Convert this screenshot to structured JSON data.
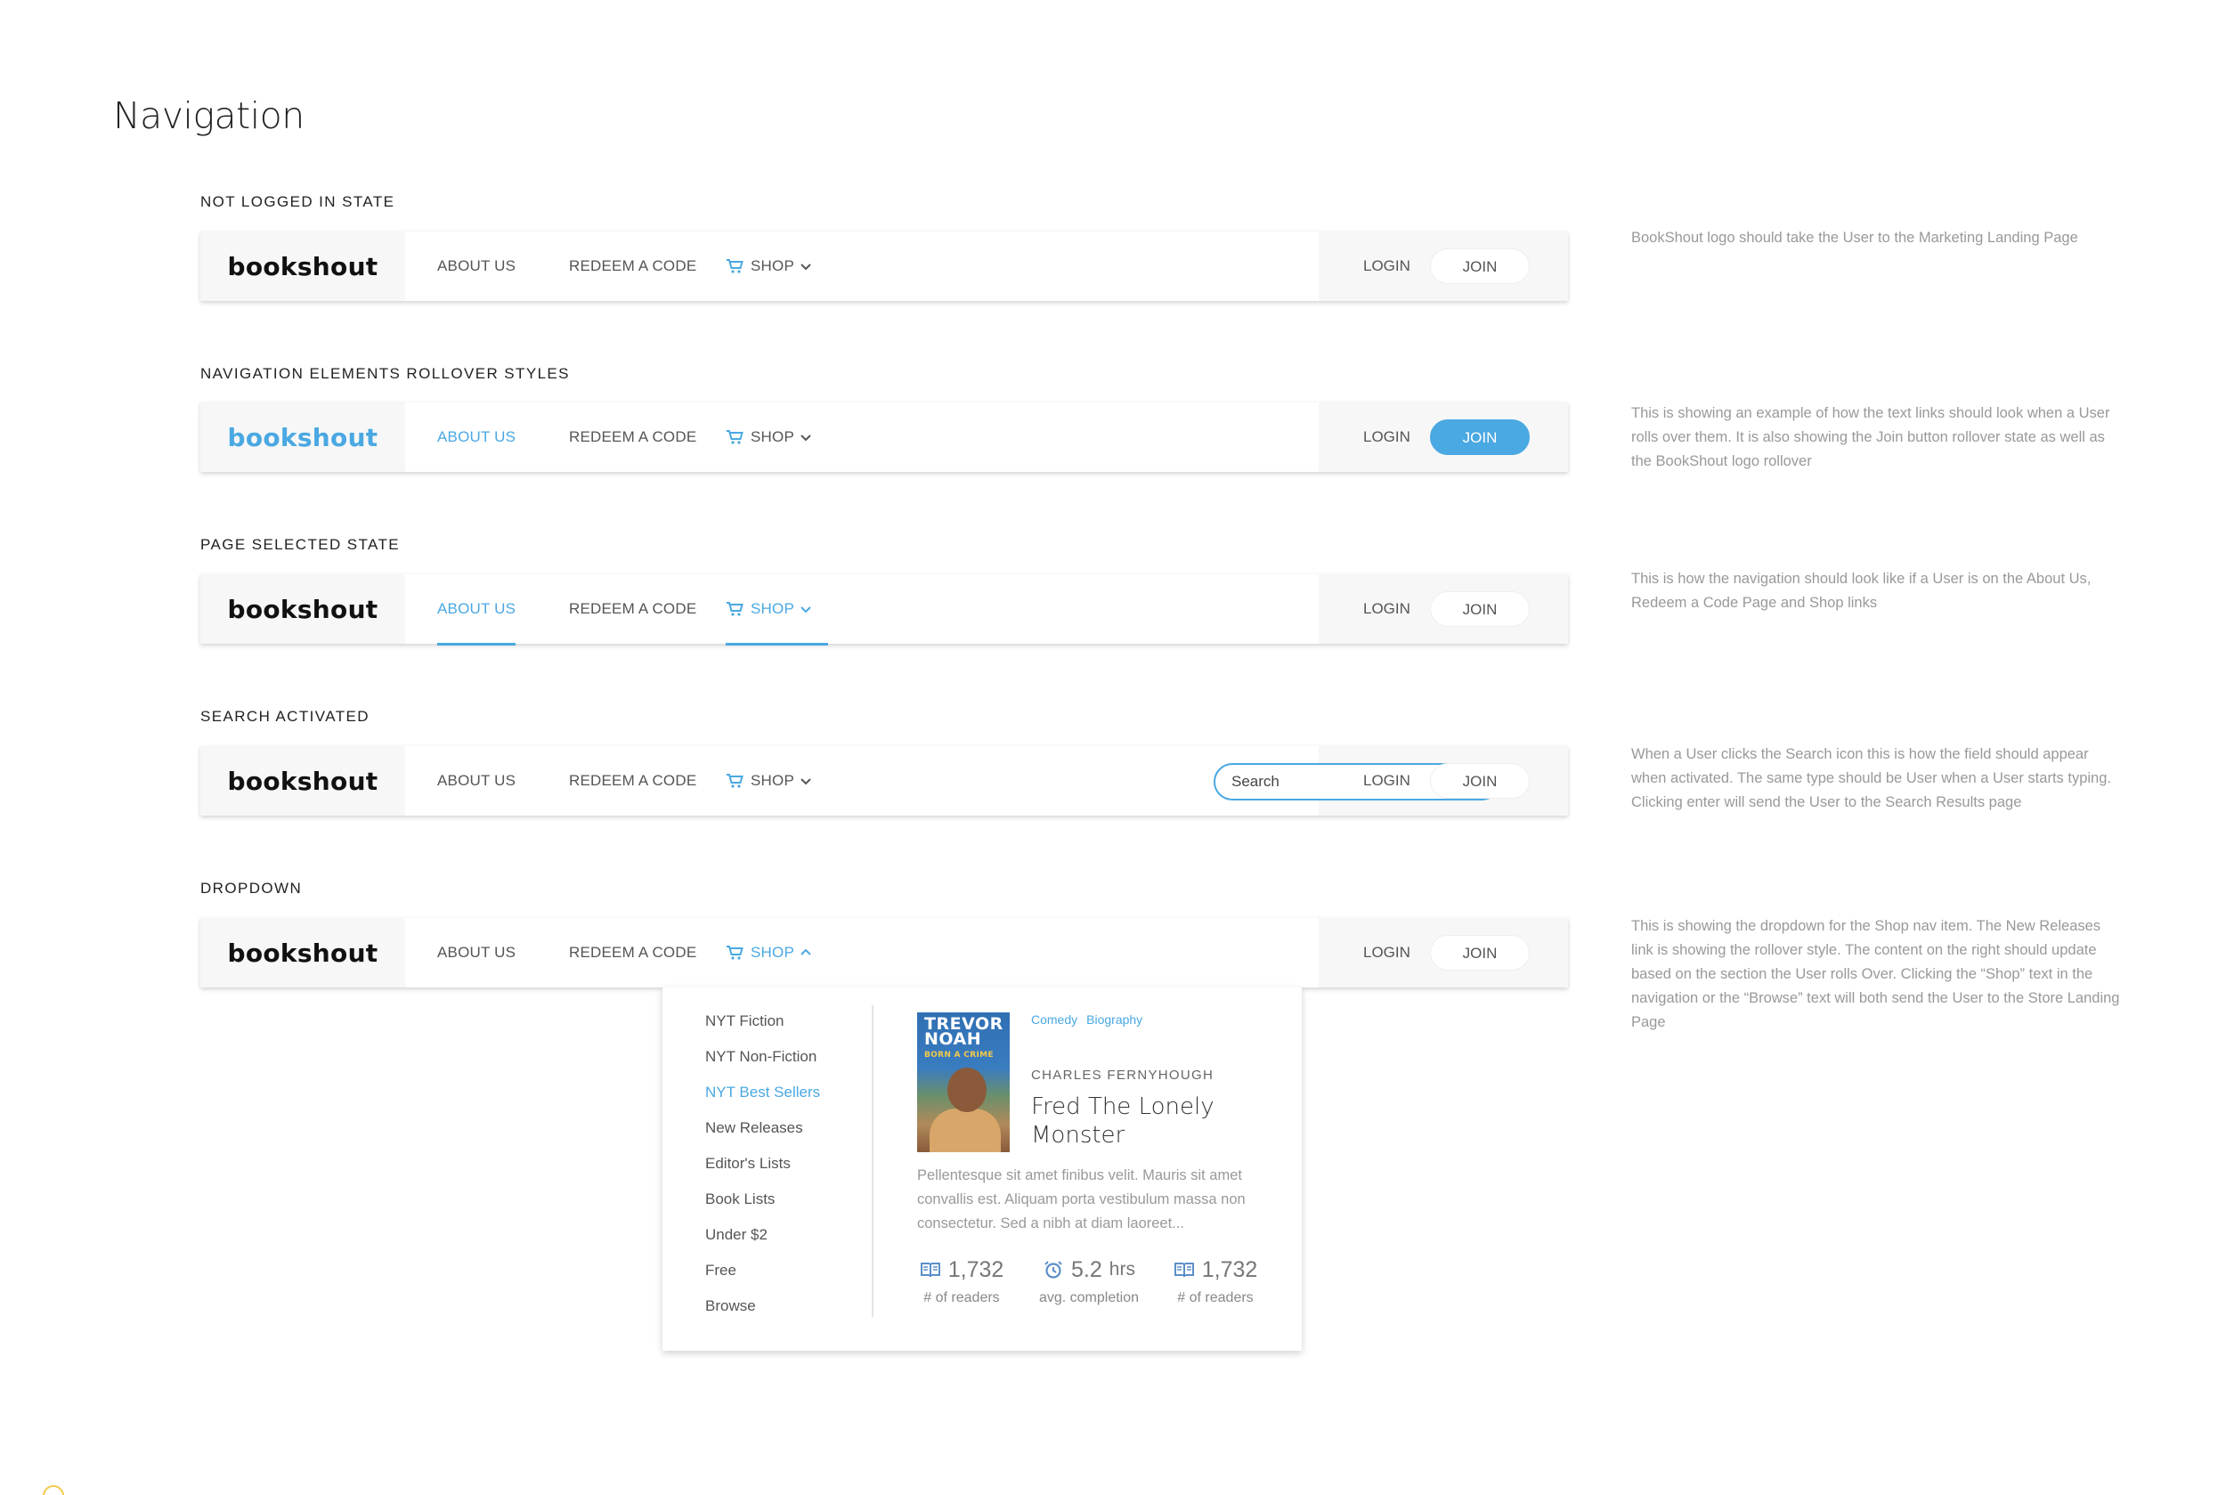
{
  "page": {
    "title": "Navigation"
  },
  "nav": {
    "logo": "bookshout",
    "about": "ABOUT US",
    "redeem": "REDEEM A CODE",
    "shop": "SHOP",
    "login": "LOGIN",
    "join": "JOIN",
    "search_placeholder": "Search"
  },
  "sections": [
    {
      "label": "NOT LOGGED IN STATE",
      "note": "BookShout logo should take the User to the Marketing Landing Page"
    },
    {
      "label": "NAVIGATION ELEMENTS ROLLOVER STYLES",
      "note": "This is showing an example of how the text links should look when a User rolls over them. It is also showing the Join button rollover state as well as the BookShout logo rollover"
    },
    {
      "label": "PAGE SELECTED STATE",
      "note": "This is how the navigation should look like if a User is on the About Us, Redeem a Code Page and Shop links"
    },
    {
      "label": "SEARCH ACTIVATED",
      "note": "When a User clicks the Search icon this is how the field should appear when activated. The same type should be User when a User starts typing. Clicking enter will send the User to the Search Results page"
    },
    {
      "label": "DROPDOWN",
      "note": "This is showing the dropdown for the Shop nav item. The New Releases link is showing the rollover style. The content on the right should update based on the section the User rolls Over. Clicking the “Shop” text in the navigation or the “Browse” text will both send the User to the Store Landing Page"
    }
  ],
  "dropdown": {
    "items": [
      "NYT Fiction",
      "NYT Non-Fiction",
      "NYT Best Sellers",
      "New Releases",
      "Editor's Lists",
      "Book Lists",
      "Under $2",
      "Free",
      "Browse"
    ],
    "highlighted_index": 2,
    "book": {
      "cover_title": "TREVOR NOAH",
      "cover_subtitle": "BORN A CRIME",
      "genres": [
        "Comedy",
        "Biography"
      ],
      "author": "CHARLES FERNYHOUGH",
      "title": "Fred The Lonely Monster",
      "description": "Pellentesque sit amet finibus velit. Mauris sit amet convallis est. Aliquam porta vestibulum massa non consectetur. Sed a nibh at diam laoreet...",
      "stats": [
        {
          "value": "1,732",
          "unit": "",
          "label": "# of readers",
          "icon": "book-icon"
        },
        {
          "value": "5.2",
          "unit": "hrs",
          "label": "avg. completion",
          "icon": "alarm-clock-icon"
        },
        {
          "value": "1,732",
          "unit": "",
          "label": "# of readers",
          "icon": "book-icon"
        }
      ]
    }
  },
  "colors": {
    "accent": "#4aa8e2",
    "text": "#555555",
    "muted": "#999999"
  }
}
